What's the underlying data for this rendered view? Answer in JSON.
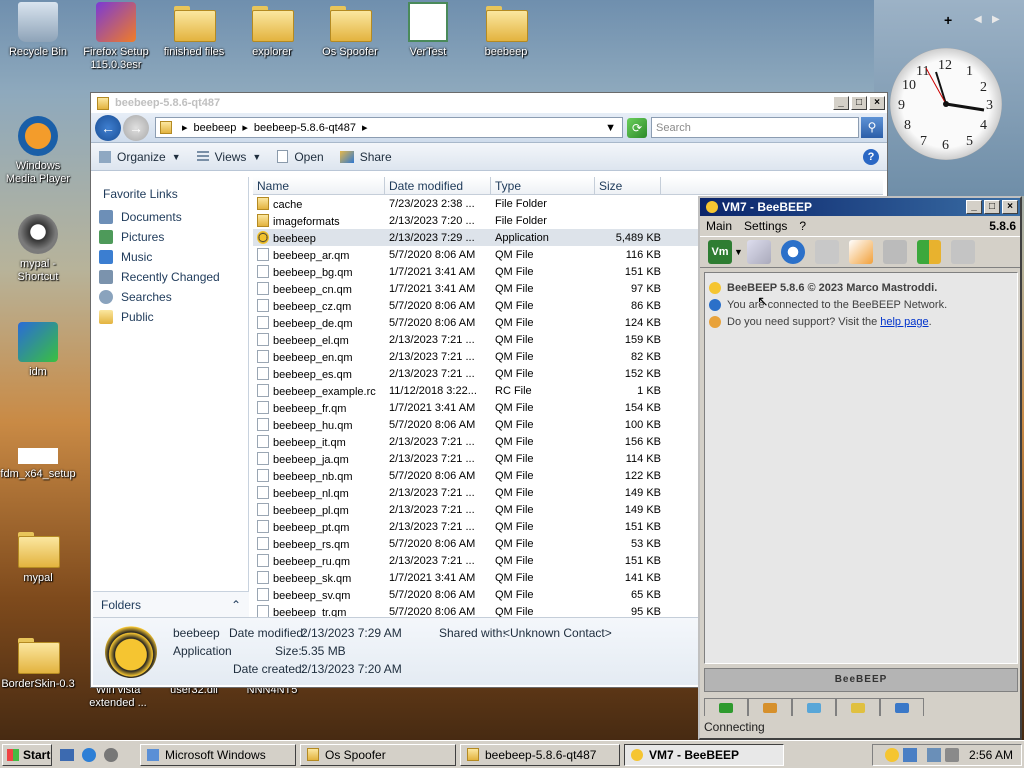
{
  "desktop": {
    "icons": [
      {
        "label": "Recycle Bin"
      },
      {
        "label": "Firefox Setup 115.0.3esr"
      },
      {
        "label": "finished files"
      },
      {
        "label": "explorer"
      },
      {
        "label": "Os Spoofer"
      },
      {
        "label": "VerTest"
      },
      {
        "label": "beebeep"
      },
      {
        "label": "Windows Media Player"
      },
      {
        "label": "mypal - Shortcut"
      },
      {
        "label": "idm"
      },
      {
        "label": "fdm_x64_setup"
      },
      {
        "label": "mypal"
      },
      {
        "label": "BorderSkin-0.3"
      },
      {
        "label": "Win vista extended ..."
      },
      {
        "label": "user32.dll"
      },
      {
        "label": "NNN4NT5"
      }
    ]
  },
  "clock": {
    "numbers": [
      "12",
      "1",
      "2",
      "3",
      "4",
      "5",
      "6",
      "7",
      "8",
      "9",
      "10",
      "11"
    ]
  },
  "explorer": {
    "title": "beebeep-5.8.6-qt487",
    "breadcrumb": [
      "beebeep",
      "beebeep-5.8.6-qt487"
    ],
    "search_placeholder": "Search",
    "toolbar": {
      "organize": "Organize",
      "views": "Views",
      "open": "Open",
      "share": "Share"
    },
    "favorites_header": "Favorite Links",
    "favorites": [
      "Documents",
      "Pictures",
      "Music",
      "Recently Changed",
      "Searches",
      "Public"
    ],
    "folders_label": "Folders",
    "columns": [
      "Name",
      "Date modified",
      "Type",
      "Size"
    ],
    "files": [
      {
        "name": "cache",
        "date": "7/23/2023 2:38 ...",
        "type": "File Folder",
        "size": "",
        "icon": "folder"
      },
      {
        "name": "imageformats",
        "date": "2/13/2023 7:20 ...",
        "type": "File Folder",
        "size": "",
        "icon": "folder"
      },
      {
        "name": "beebeep",
        "date": "2/13/2023 7:29 ...",
        "type": "Application",
        "size": "5,489 KB",
        "icon": "app"
      },
      {
        "name": "beebeep_ar.qm",
        "date": "5/7/2020 8:06 AM",
        "type": "QM File",
        "size": "116 KB",
        "icon": "doc"
      },
      {
        "name": "beebeep_bg.qm",
        "date": "1/7/2021 3:41 AM",
        "type": "QM File",
        "size": "151 KB",
        "icon": "doc"
      },
      {
        "name": "beebeep_cn.qm",
        "date": "1/7/2021 3:41 AM",
        "type": "QM File",
        "size": "97 KB",
        "icon": "doc"
      },
      {
        "name": "beebeep_cz.qm",
        "date": "5/7/2020 8:06 AM",
        "type": "QM File",
        "size": "86 KB",
        "icon": "doc"
      },
      {
        "name": "beebeep_de.qm",
        "date": "5/7/2020 8:06 AM",
        "type": "QM File",
        "size": "124 KB",
        "icon": "doc"
      },
      {
        "name": "beebeep_el.qm",
        "date": "2/13/2023 7:21 ...",
        "type": "QM File",
        "size": "159 KB",
        "icon": "doc"
      },
      {
        "name": "beebeep_en.qm",
        "date": "2/13/2023 7:21 ...",
        "type": "QM File",
        "size": "82 KB",
        "icon": "doc"
      },
      {
        "name": "beebeep_es.qm",
        "date": "2/13/2023 7:21 ...",
        "type": "QM File",
        "size": "152 KB",
        "icon": "doc"
      },
      {
        "name": "beebeep_example.rc",
        "date": "11/12/2018 3:22...",
        "type": "RC File",
        "size": "1 KB",
        "icon": "doc"
      },
      {
        "name": "beebeep_fr.qm",
        "date": "1/7/2021 3:41 AM",
        "type": "QM File",
        "size": "154 KB",
        "icon": "doc"
      },
      {
        "name": "beebeep_hu.qm",
        "date": "5/7/2020 8:06 AM",
        "type": "QM File",
        "size": "100 KB",
        "icon": "doc"
      },
      {
        "name": "beebeep_it.qm",
        "date": "2/13/2023 7:21 ...",
        "type": "QM File",
        "size": "156 KB",
        "icon": "doc"
      },
      {
        "name": "beebeep_ja.qm",
        "date": "2/13/2023 7:21 ...",
        "type": "QM File",
        "size": "114 KB",
        "icon": "doc"
      },
      {
        "name": "beebeep_nb.qm",
        "date": "5/7/2020 8:06 AM",
        "type": "QM File",
        "size": "122 KB",
        "icon": "doc"
      },
      {
        "name": "beebeep_nl.qm",
        "date": "2/13/2023 7:21 ...",
        "type": "QM File",
        "size": "149 KB",
        "icon": "doc"
      },
      {
        "name": "beebeep_pl.qm",
        "date": "2/13/2023 7:21 ...",
        "type": "QM File",
        "size": "149 KB",
        "icon": "doc"
      },
      {
        "name": "beebeep_pt.qm",
        "date": "2/13/2023 7:21 ...",
        "type": "QM File",
        "size": "151 KB",
        "icon": "doc"
      },
      {
        "name": "beebeep_rs.qm",
        "date": "5/7/2020 8:06 AM",
        "type": "QM File",
        "size": "53 KB",
        "icon": "doc"
      },
      {
        "name": "beebeep_ru.qm",
        "date": "2/13/2023 7:21 ...",
        "type": "QM File",
        "size": "151 KB",
        "icon": "doc"
      },
      {
        "name": "beebeep_sk.qm",
        "date": "1/7/2021 3:41 AM",
        "type": "QM File",
        "size": "141 KB",
        "icon": "doc"
      },
      {
        "name": "beebeep_sv.qm",
        "date": "5/7/2020 8:06 AM",
        "type": "QM File",
        "size": "65 KB",
        "icon": "doc"
      },
      {
        "name": "beebeep_tr.qm",
        "date": "5/7/2020 8:06 AM",
        "type": "QM File",
        "size": "95 KB",
        "icon": "doc"
      }
    ],
    "details": {
      "name": "beebeep",
      "type": "Application",
      "date_modified_label": "Date modified:",
      "date_modified": "2/13/2023 7:29 AM",
      "size_label": "Size:",
      "size": "5.35 MB",
      "date_created_label": "Date created:",
      "date_created": "2/13/2023 7:20 AM",
      "shared_label": "Shared with:",
      "shared": "<Unknown Contact>"
    }
  },
  "beebeep": {
    "title": "VM7 - BeeBEEP",
    "menu": [
      "Main",
      "Settings",
      "?"
    ],
    "version_badge": "5.8.6",
    "vm_label": "Vm",
    "lines": [
      "BeeBEEP 5.8.6 © 2023 Marco Mastroddi.",
      "You are connected to the BeeBEEP Network.",
      "Do you need support? Visit the"
    ],
    "help_link": "help page",
    "help_suffix": ".",
    "banner": "BeeBEEP",
    "status": "Connecting"
  },
  "taskbar": {
    "start": "Start",
    "tasks": [
      "Microsoft Windows",
      "Os Spoofer",
      "beebeep-5.8.6-qt487",
      "VM7 - BeeBEEP"
    ],
    "time": "2:56 AM"
  }
}
